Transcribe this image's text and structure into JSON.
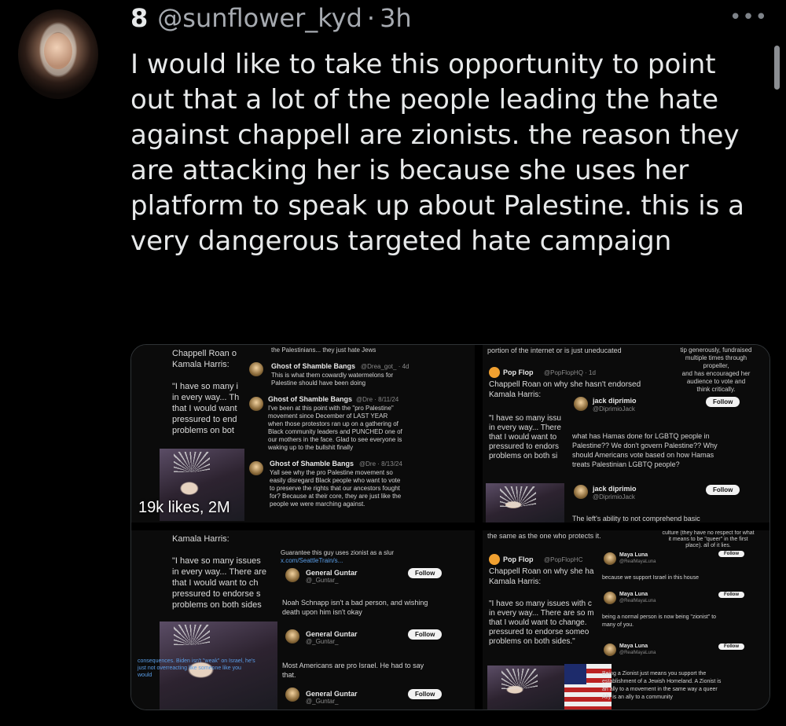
{
  "tweet": {
    "display_name": "8",
    "handle": "@sunflower_kyd",
    "separator": "·",
    "time": "3h",
    "more_icon": "more-horizontal-icon",
    "text": "I would like to take this opportunity to point out that a lot of the people leading the hate against chappell are zionists. the reason they are attacking her is because she uses her platform to speak up about Palestine. this is a very dangerous targeted hate campaign"
  },
  "media": {
    "overlay_likes": "19k likes, 2M",
    "panel1": {
      "left_text": "Chappell Roan o\nKamala Harris:\n\n\"I have so many i\nin every way... Th\nthat I would want\npressured to end\nproblems on bot",
      "top_text": "the Palestinians... they just hate Jews",
      "replies": [
        {
          "name": "Ghost of Shamble Bangs",
          "handle": "@Drea_got_ · 4d",
          "body": "This is what them cowardly watermelons for\nPalestine should have been doing"
        },
        {
          "name": "Ghost of Shamble Bangs",
          "handle": "@Dre · 8/11/24",
          "body": "I've been at this point with the \"pro Palestine\"\nmovement since December of LAST YEAR\nwhen those protestors ran up on a gathering of\nBlack community leaders and PUNCHED one of\nour mothers in the face. Glad to see everyone is\nwaking up to the bullshit finally"
        },
        {
          "name": "Ghost of Shamble Bangs",
          "handle": "@Dre · 8/13/24",
          "body": "Yall see why the pro Palestine movement so\neasily disregard Black people who want to vote\nto preserve the rights that our ancestors fought\nfor? Because at their core, they are just like the\npeople we were marching against."
        }
      ]
    },
    "panel2": {
      "top_text": "portion of the internet or is just uneducated",
      "side_text": "tip generously, fundraised\nmultiple times through\npropeller,\nand has encouraged her\naudience to vote and\nthink critically.",
      "author_name": "Pop Flop",
      "author_handle": "@PopFlopHQ · 1d",
      "headline": "Chappell Roan on why she hasn't endorsed\nKamala Harris:",
      "quote": "\"I have so many issu\nin every way... There\nthat I would want to\npressured to endors\nproblems on both si",
      "reply1_name": "jack diprimio",
      "reply1_handle": "@DiprimioJack",
      "reply1_body": "what has Hamas done for LGBTQ people in\nPalestine?? We don't govern Palestine?? Why\nshould Americans vote based on how Hamas\ntreats Palestinian LGBTQ people?",
      "reply2_name": "jack diprimio",
      "reply2_handle": "@DiprimioJack",
      "bottom_text": "The left's ability to not comprehend basic",
      "follow": "Follow"
    },
    "panel3": {
      "left_text": "Kamala Harris:\n\n\"I have so many issues\nin every way... There are\nthat I would want to ch\npressured to endorse s\nproblems on both sides",
      "quote_tweet": "Guarantee this guy uses zionist as a slur",
      "quote_link": "x.com/SeattleTrain/s...",
      "reply1_name": "General Guntar",
      "reply1_handle": "@_Guntar_",
      "reply1_body": "Noah Schnapp isn't a bad person, and wishing\ndeath upon him isn't okay",
      "reply2_name": "General Guntar",
      "reply2_handle": "@_Guntar_",
      "reply2_body": "Most Americans are pro Israel. He had to say\nthat.",
      "reply3_name": "General Guntar",
      "reply3_handle": "@_Guntar_",
      "bottom_left": "consequences. Biden isn't \"weak\" on Israel, he's\njust not overreacting like someone like you\nwould",
      "follow": "Follow"
    },
    "panel4": {
      "top_text": "the same as the one who protects it.",
      "side_text": "culture (they have no respect for what\nit means to be \"queer\" in the first\nplace). all of it lies.",
      "author_name": "Pop Flop",
      "author_handle": "@PopFlopHC",
      "headline": "Chappell Roan on why she ha\nKamala Harris:",
      "quote": "\"I have so many issues with c\nin every way... There are so m\nthat I would want to change.\npressured to endorse someo\nproblems on both sides.\"",
      "reply1_name": "Maya Luna",
      "reply1_handle": "@RealMayaLuna",
      "reply1_body": "because we support Israel in this house",
      "reply2_name": "Maya Luna",
      "reply2_handle": "@RealMayaLuna",
      "reply2_body": "being a normal person is now being \"zionist\" to\nmany of you.",
      "reply3_name": "Maya Luna",
      "reply3_handle": "@RealMayaLuna",
      "reply3_body": "Being a Zionist just means you support the\nestablishment of a Jewish Homeland. A Zionist is\nan ally to a movement in the same way a queer\nAlly is an ally to a community",
      "follow": "Follow"
    }
  }
}
